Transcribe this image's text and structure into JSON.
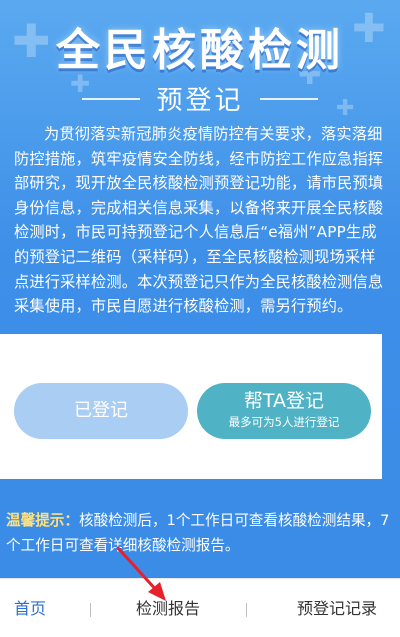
{
  "header": {
    "title": "全民核酸检测",
    "subtitle": "预登记"
  },
  "intro": {
    "text": "为贯彻落实新冠肺炎疫情防控有关要求，落实落细防控措施，筑牢疫情安全防线，经市防控工作应急指挥部研究，现开放全民核酸检测预登记功能，请市民预填身份信息，完成相关信息采集，以备将来开展全民核酸检测时，市民可持预登记个人信息后“e福州”APP生成的预登记二维码（采样码），至全民核酸检测现场采样点进行采样检测。本次预登记只作为全民核酸检测信息采集使用，市民自愿进行核酸检测，需另行预约。"
  },
  "actions": {
    "registered_label": "已登记",
    "help_label": "帮TA登记",
    "help_sub": "最多可为5人进行登记"
  },
  "tip": {
    "label": "温馨提示：",
    "text": "核酸检测后，1个工作日可查看核酸检测结果，7个工作日可查看详细核酸检测报告。"
  },
  "tabbar": {
    "home": "首页",
    "report": "检测报告",
    "records": "预登记记录"
  },
  "colors": {
    "accent": "#3a8be5",
    "registered_button": "#a9cdf3",
    "help_button": "#4fb2c5",
    "tip_label": "#ffe07a",
    "annotation_arrow": "#e8202a"
  },
  "icons": {
    "decoration": "plus-cross-icon",
    "annotation": "red-arrow-icon"
  }
}
